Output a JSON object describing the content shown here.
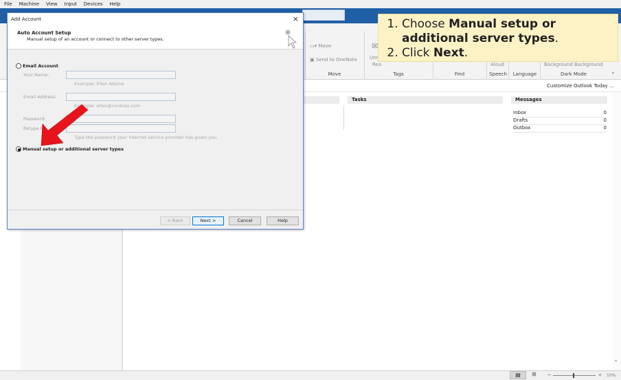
{
  "vbox_menu": [
    "File",
    "Machine",
    "View",
    "Input",
    "Devices",
    "Help"
  ],
  "ribbon": {
    "move_label": "Move",
    "send_onenote": "Send to OneNote",
    "unread_label": "Unr",
    "unread_sub": "Rea",
    "aloud_label": "Aloud",
    "background_label": "Background  Background",
    "group_labels": {
      "move": "Move",
      "tags": "Tags",
      "find": "Find",
      "speech": "Speech",
      "language": "Language",
      "dark_mode": "Dark Mode"
    }
  },
  "today": {
    "customize_link": "Customize Outlook Today ...",
    "tasks_header": "Tasks",
    "messages_header": "Messages",
    "messages": [
      {
        "folder": "Inbox",
        "count": "0"
      },
      {
        "folder": "Drafts",
        "count": "0"
      },
      {
        "folder": "Outbox",
        "count": "0"
      }
    ]
  },
  "tooltip": {
    "step1_prefix": "Choose ",
    "step1_bold": "Manual setup or additional server types",
    "step1_suffix": ".",
    "step2_prefix": "Click ",
    "step2_bold": "Next",
    "step2_suffix": "."
  },
  "dialog": {
    "title": "Add Account",
    "close": "×",
    "header_title": "Auto Account Setup",
    "header_sub": "Manual setup of an account or connect to other server types.",
    "email_account_label": "Email Account",
    "your_name_label": "Your Name:",
    "your_name_hint": "Example: Ellen Adams",
    "email_label": "Email Address:",
    "email_hint": "Example: ellen@contoso.com",
    "password_label": "Password:",
    "retype_label": "Retype Pa",
    "password_hint": "Type the password your Internet service provider has given you.",
    "manual_label": "Manual setup or additional server types",
    "buttons": {
      "back": "< Back",
      "next": "Next >",
      "cancel": "Cancel",
      "help": "Help"
    }
  },
  "status": {
    "zoom": "10%"
  },
  "colors": {
    "outlook_blue": "#1f5fa6",
    "tooltip_bg": "#fdf2c6",
    "arrow_red": "#e8141c"
  }
}
